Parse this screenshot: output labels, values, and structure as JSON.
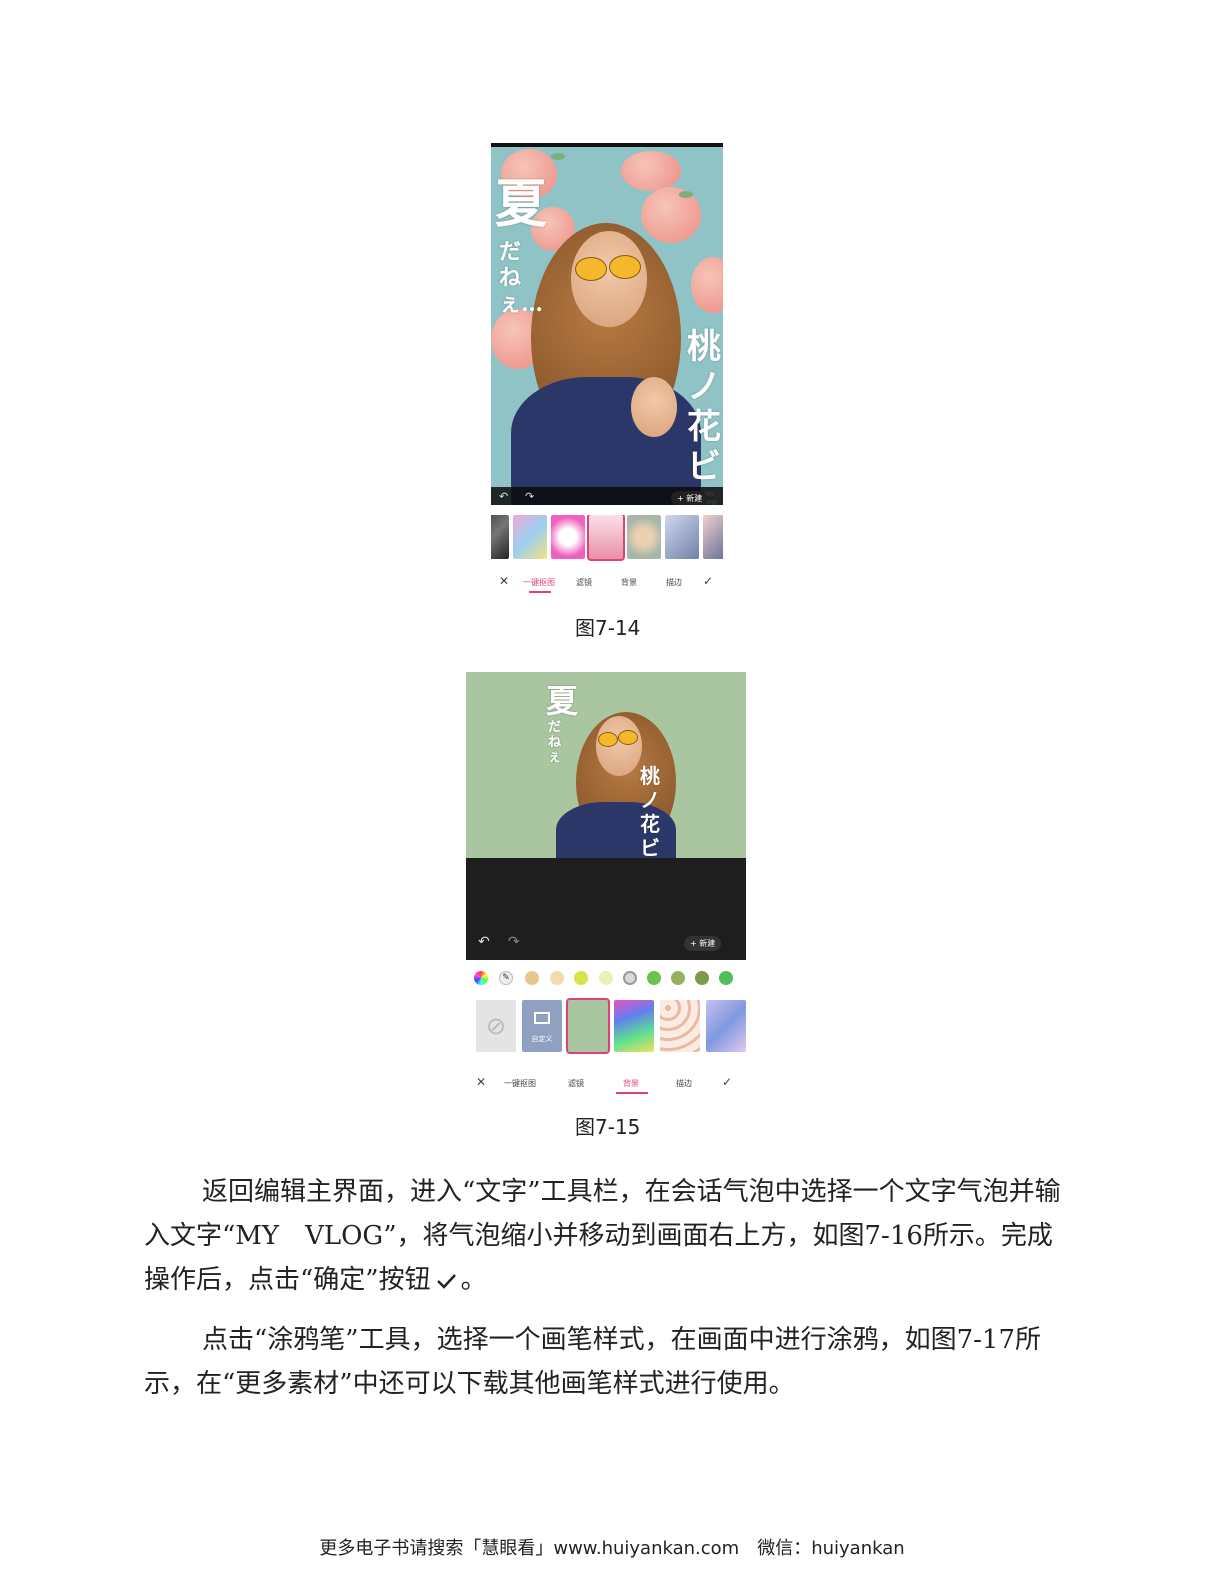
{
  "figure1": {
    "caption": "图7-14",
    "canvas_text": {
      "big_left": "夏",
      "sub_left": "だねぇ…",
      "big_right": "桃ノ花ビラ"
    },
    "new_button": "+ 新建",
    "tabs": [
      "一键抠图",
      "滤镜",
      "背景",
      "描边"
    ],
    "active_tab": "一键抠图",
    "close_icon": "close-icon",
    "confirm_icon": "check-icon"
  },
  "figure2": {
    "caption": "图7-15",
    "canvas_text": {
      "big_left": "夏",
      "sub_left": "だねぇ",
      "big_right": "桃ノ花ビラ"
    },
    "new_button": "+ 新建",
    "custom_label": "自定义",
    "tabs": [
      "一键抠图",
      "滤镜",
      "背景",
      "描边"
    ],
    "active_tab": "背景",
    "swatch_colors": [
      "#e6c88f",
      "#f0dcae",
      "#d8e24a",
      "#eef0b6",
      "#d9d9d9",
      "#6cc24a",
      "#97b060",
      "#7f9a4a",
      "#4fbf5a"
    ]
  },
  "paragraphs": [
    "返回编辑主界面，进入“文字”工具栏，在会话气泡中选择一个文字气泡并输入文字“MY　VLOG”，将气泡缩小并移动到画面右上方，如图7-16所示。完成操作后，点击“确定”按钮",
    "。",
    "点击“涂鸦笔”工具，选择一个画笔样式，在画面中进行涂鸦，如图7-17所示，在“更多素材”中还可以下载其他画笔样式进行使用。"
  ],
  "footer": "更多电子书请搜索「慧眼看」www.huiyankan.com　微信：huiyankan"
}
